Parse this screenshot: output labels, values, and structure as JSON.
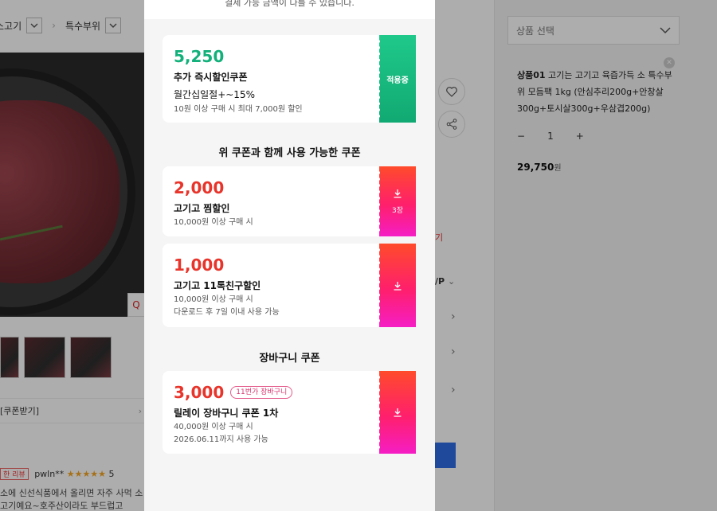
{
  "background": {
    "breadcrumb": [
      "소고기",
      "특수부위"
    ],
    "coupon_link": "[쿠폰받기]",
    "review": {
      "badge": "한 리뷰",
      "user": "pwln**",
      "stars": "★★★★★",
      "score": "5"
    },
    "review_text": "소에 신선식품에서 올리면 자주 사먹 소고기예요~호주산이라도 부드럽고",
    "mid_frag1": "기",
    "mid_frag2": "/P",
    "option_panel": {
      "select_placeholder": "상품 선택",
      "option_name_bold": "상품01",
      "option_name": " 고기는 고기고 육즙가득 소 특수부위 모듬팩 1kg (안심추리200g+안창살300g+토시살300g+우삼겹200g)",
      "quantity": "1",
      "price": "29,750",
      "price_unit": "원"
    }
  },
  "modal": {
    "top_notice": "결제 가능 금액이 다를 수 있습니다.",
    "applied_coupon": {
      "amount": "5,250",
      "title": "추가 즉시할인쿠폰",
      "subtitle": "월간십일절+~15%",
      "condition": "10원 이상 구매 시 최대 7,000원 할인",
      "status": "적용중",
      "color": "#12b07a"
    },
    "section_with": "위 쿠폰과 함께 사용 가능한 쿠폰",
    "coupons": [
      {
        "amount": "2,000",
        "title": "고기고 찜할인",
        "condition": "10,000원 이상 구매 시",
        "count": "3장"
      },
      {
        "amount": "1,000",
        "title": "고기고 11톡친구할인",
        "condition": "10,000원 이상 구매 시",
        "note": "다운로드 후 7일 이내 사용 가능"
      }
    ],
    "section_cart": "장바구니 쿠폰",
    "cart_coupon": {
      "amount": "3,000",
      "tag": "11번가 장바구니",
      "title": "릴레이 장바구니 쿠폰 1차",
      "condition": "40,000원 이상 구매 시",
      "note": "2026.06.11까지 사용 가능"
    },
    "accent_red": "#e8342a"
  }
}
